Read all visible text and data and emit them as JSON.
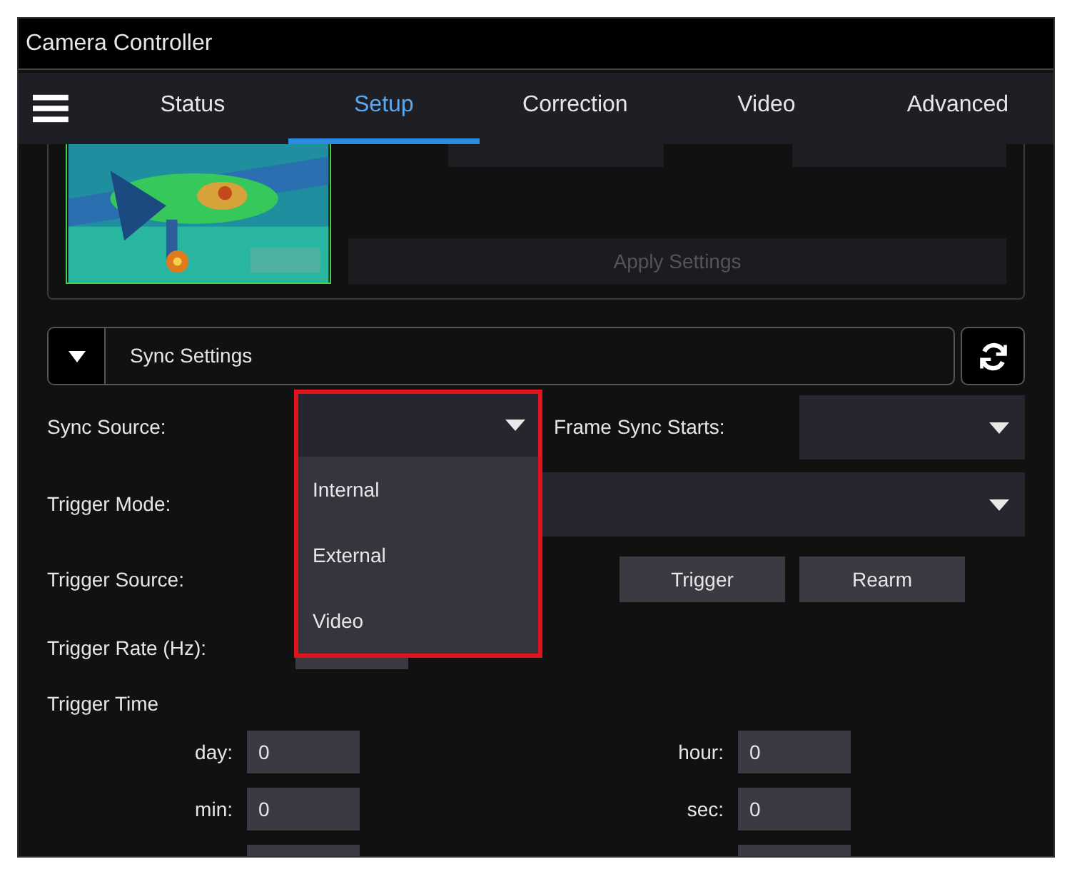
{
  "window": {
    "title": "Camera Controller"
  },
  "tabs": [
    {
      "label": "Status",
      "selected": false
    },
    {
      "label": "Setup",
      "selected": true
    },
    {
      "label": "Correction",
      "selected": false
    },
    {
      "label": "Video",
      "selected": false
    },
    {
      "label": "Advanced",
      "selected": false
    }
  ],
  "apply_button": {
    "label": "Apply Settings",
    "disabled": true
  },
  "section": {
    "title": "Sync Settings",
    "expanded": true
  },
  "sync_source": {
    "label": "Sync Source:",
    "open": true,
    "options": [
      "Internal",
      "External",
      "Video"
    ]
  },
  "frame_sync_starts": {
    "label": "Frame Sync Starts:"
  },
  "trigger_mode": {
    "label": "Trigger Mode:"
  },
  "trigger_source": {
    "label": "Trigger Source:"
  },
  "buttons": [
    "Trigger",
    "Rearm"
  ],
  "trigger_rate": {
    "label": "Trigger Rate (Hz):"
  },
  "trigger_time": {
    "title": "Trigger Time",
    "fields": [
      {
        "label": "day:",
        "value": "0"
      },
      {
        "label": "hour:",
        "value": "0"
      },
      {
        "label": "min:",
        "value": "0"
      },
      {
        "label": "sec:",
        "value": "0"
      }
    ]
  }
}
